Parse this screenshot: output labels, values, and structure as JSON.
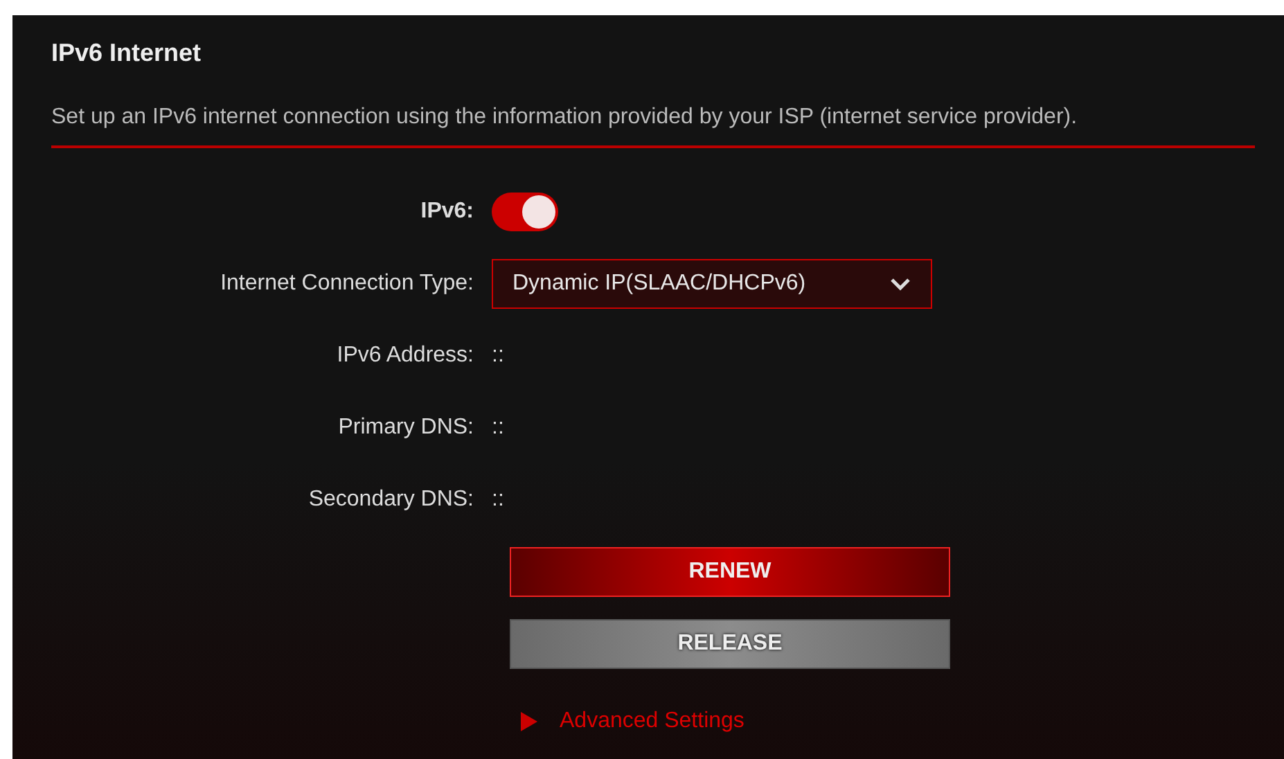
{
  "panel": {
    "title": "IPv6 Internet",
    "description": "Set up an IPv6 internet connection using the information provided by your ISP (internet service provider)."
  },
  "fields": [
    {
      "kind": "toggle",
      "label": "IPv6:",
      "on": true
    },
    {
      "kind": "select",
      "label": "Internet Connection Type:",
      "value": "Dynamic IP(SLAAC/DHCPv6)"
    },
    {
      "kind": "text",
      "label": "IPv6 Address:",
      "value": "::"
    },
    {
      "kind": "text",
      "label": "Primary DNS:",
      "value": "::"
    },
    {
      "kind": "text",
      "label": "Secondary DNS:",
      "value": "::"
    }
  ],
  "buttons": [
    {
      "label": "RENEW",
      "disabled": false
    },
    {
      "label": "RELEASE",
      "disabled": true
    }
  ],
  "advanced_settings": {
    "label": "Advanced Settings",
    "expanded": false
  }
}
